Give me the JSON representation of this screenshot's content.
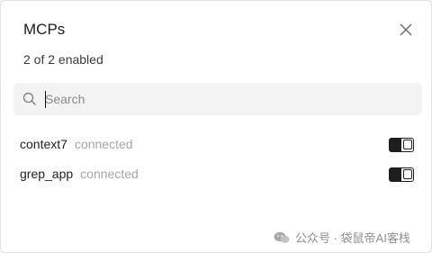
{
  "dialog": {
    "title": "MCPs",
    "subtitle": "2 of 2 enabled",
    "close_icon": "close-icon"
  },
  "search": {
    "placeholder": "Search",
    "value": ""
  },
  "servers": [
    {
      "name": "context7",
      "status": "connected",
      "enabled": true
    },
    {
      "name": "grep_app",
      "status": "connected",
      "enabled": true
    }
  ],
  "watermark": {
    "text": "公众号 · 袋鼠帝AI客栈",
    "icon": "wechat-icon"
  },
  "colors": {
    "status_text": "#a6a6a6",
    "toggle": "#1e1e1e",
    "search_bg": "#f3f3f3"
  }
}
